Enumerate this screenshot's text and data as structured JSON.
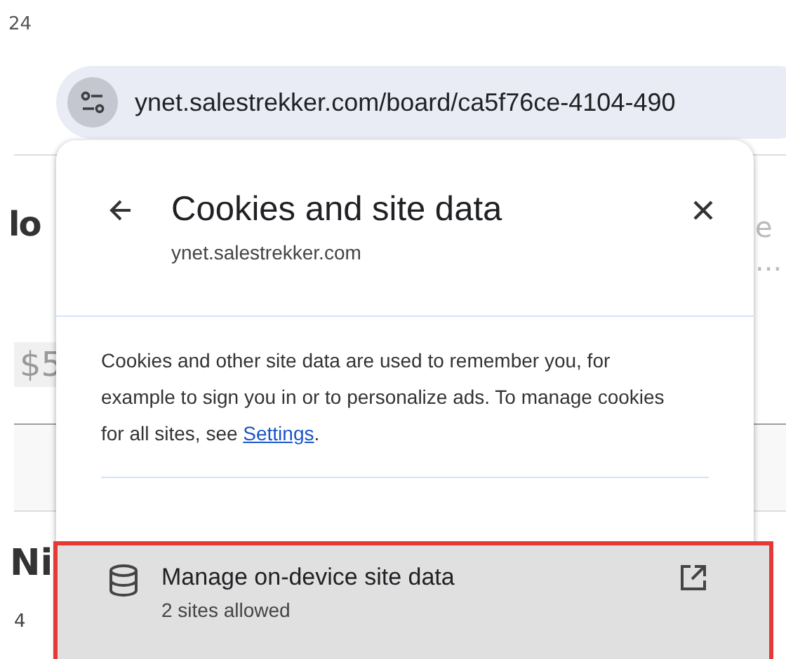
{
  "background_page": {
    "fragments": [
      {
        "kind": "date",
        "text": "24"
      },
      {
        "kind": "heading",
        "text": "lo"
      },
      {
        "kind": "amount",
        "text": "$5"
      },
      {
        "kind": "name",
        "text": "Ni"
      },
      {
        "kind": "number",
        "text": "4"
      },
      {
        "kind": "hint",
        "text": "e ..."
      }
    ]
  },
  "address_bar": {
    "url": "ynet.salestrekker.com/board/ca5f76ce-4104-490"
  },
  "popup": {
    "title": "Cookies and site data",
    "subtitle": "ynet.salestrekker.com",
    "description": "Cookies and other site data are used to remember you, for example to sign you in or to personalize ads. To manage cookies for all sites, see ",
    "link": "Settings",
    "description_end": ".",
    "item": {
      "title": "Manage on-device site data",
      "subtitle": "2 sites allowed",
      "highlighted": true
    }
  }
}
